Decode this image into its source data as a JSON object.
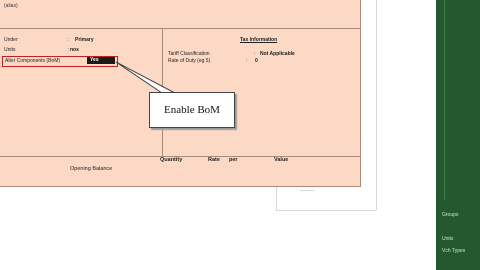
{
  "header": {
    "top_text": "(alias)"
  },
  "item": {
    "under_label": "Under",
    "under_value": "Primary",
    "units_label": "Units",
    "units_value": "nos",
    "alter_components_label": "Alter Components (BoM)",
    "alter_components_value": "Yes"
  },
  "tax": {
    "heading": "Tax Information",
    "tariff_label": "Tariff Classification",
    "tariff_value": "Not Applicable",
    "rate_label": "Rate of Duty (eg 5)",
    "rate_value": "0"
  },
  "balance": {
    "col_quantity": "Quantity",
    "col_rate": "Rate",
    "col_per": "per",
    "col_value": "Value",
    "opening_label": "Opening Balance"
  },
  "callout": {
    "text": "Enable BoM"
  },
  "sidebar": {
    "items": [
      {
        "label": "Groups"
      },
      {
        "label": "Units"
      },
      {
        "label": "Vch Types"
      }
    ]
  },
  "colors": {
    "panel_bg": "#fcd9c5",
    "sidebar_bg": "#24592f",
    "yes_bg": "#1a1a1a",
    "highlight_border": "#c02020"
  }
}
